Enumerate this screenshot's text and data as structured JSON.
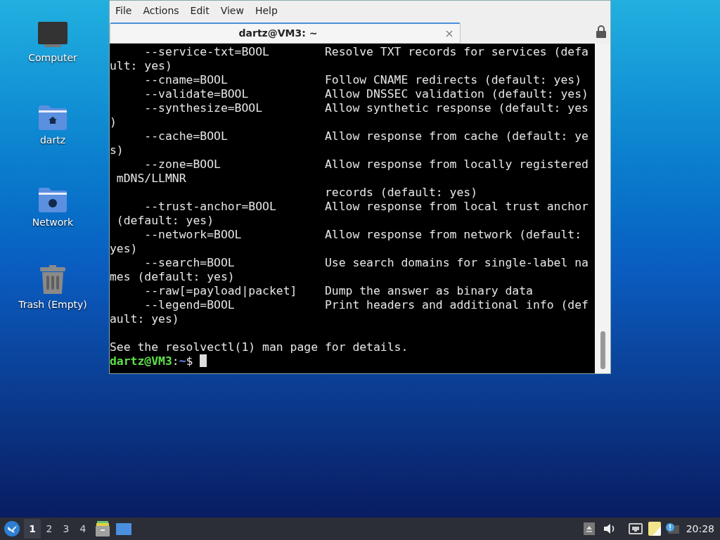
{
  "desktop_icons": [
    {
      "kind": "computer",
      "label": "Computer"
    },
    {
      "kind": "home",
      "label": "dartz"
    },
    {
      "kind": "network",
      "label": "Network"
    },
    {
      "kind": "trash",
      "label": "Trash (Empty)"
    }
  ],
  "window": {
    "menu": [
      "File",
      "Actions",
      "Edit",
      "View",
      "Help"
    ],
    "tabs": [
      {
        "title": "dartz@VM3: ~",
        "selected": true
      }
    ],
    "terminal": {
      "lines": [
        "     --service-txt=BOOL        Resolve TXT records for services (defa",
        "ult: yes)",
        "     --cname=BOOL              Follow CNAME redirects (default: yes)",
        "     --validate=BOOL           Allow DNSSEC validation (default: yes)",
        "     --synthesize=BOOL         Allow synthetic response (default: yes",
        ")",
        "     --cache=BOOL              Allow response from cache (default: ye",
        "s)",
        "     --zone=BOOL               Allow response from locally registered",
        " mDNS/LLMNR",
        "                               records (default: yes)",
        "     --trust-anchor=BOOL       Allow response from local trust anchor",
        " (default: yes)",
        "     --network=BOOL            Allow response from network (default:",
        "yes)",
        "     --search=BOOL             Use search domains for single-label na",
        "mes (default: yes)",
        "     --raw[=payload|packet]    Dump the answer as binary data",
        "     --legend=BOOL             Print headers and additional info (def",
        "ault: yes)"
      ],
      "footer": "See the resolvectl(1) man page for details.",
      "prompt": {
        "user_host": "dartz@VM3",
        "separator": ":",
        "path": "~",
        "symbol": "$"
      }
    }
  },
  "taskbar": {
    "workspaces": [
      {
        "label": "1",
        "selected": true
      },
      {
        "label": "2",
        "selected": false
      },
      {
        "label": "3",
        "selected": false
      },
      {
        "label": "4",
        "selected": false
      }
    ],
    "clock": "20:28"
  }
}
